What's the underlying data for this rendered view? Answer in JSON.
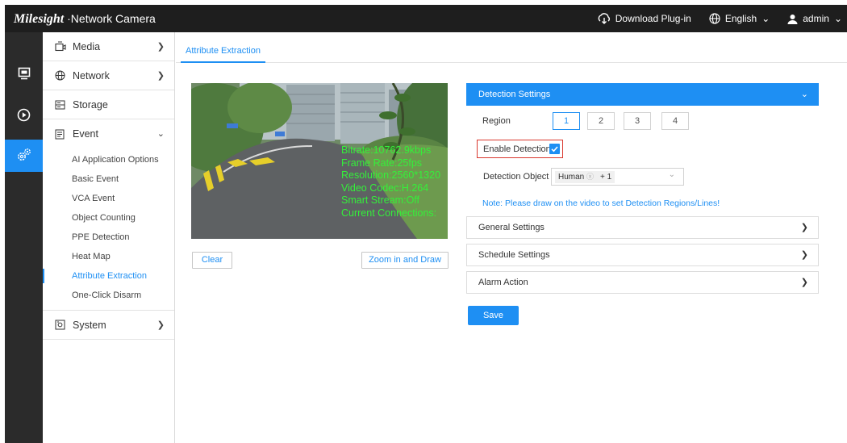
{
  "header": {
    "brand_logo": "Milesight",
    "brand_title": "Network Camera",
    "download_plugin": "Download Plug-in",
    "language": "English",
    "user": "admin"
  },
  "rail": [
    {
      "icon": "live-view-icon",
      "active": false
    },
    {
      "icon": "playback-icon",
      "active": false
    },
    {
      "icon": "settings-icon",
      "active": true
    }
  ],
  "menu": {
    "media": "Media",
    "network": "Network",
    "storage": "Storage",
    "event": "Event",
    "event_items": [
      "AI Application Options",
      "Basic Event",
      "VCA Event",
      "Object Counting",
      "PPE Detection",
      "Heat Map",
      "Attribute Extraction",
      "One-Click Disarm"
    ],
    "active_item": "Attribute Extraction",
    "system": "System"
  },
  "tab": {
    "label": "Attribute Extraction"
  },
  "video": {
    "osd": [
      "Bitrate:10762.9kbps",
      "Frame Rate:25fps",
      "Resolution:2560*1320",
      "Video Codec:H.264",
      "Smart Stream:Off",
      "Current Connections:"
    ],
    "clear_label": "Clear",
    "zoom_draw_label": "Zoom in and Draw"
  },
  "detection": {
    "header": "Detection Settings",
    "region_label": "Region",
    "regions": [
      "1",
      "2",
      "3",
      "4"
    ],
    "active_region": "1",
    "enable_label": "Enable Detection",
    "enabled": true,
    "object_label": "Detection Object",
    "object_tag": "Human",
    "object_more": "+ 1",
    "note": "Note: Please draw on the video to set Detection Regions/Lines!"
  },
  "panels": {
    "general": "General Settings",
    "schedule": "Schedule Settings",
    "alarm": "Alarm Action"
  },
  "save_label": "Save",
  "colors": {
    "accent": "#1e8ff3",
    "topbar": "#1e1e1e",
    "rail": "#2b2b2b",
    "highlight": "#d9382e",
    "osd": "#34f03a"
  }
}
